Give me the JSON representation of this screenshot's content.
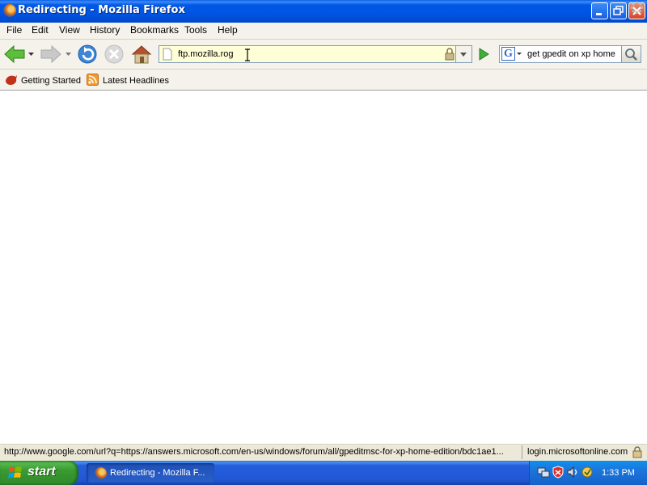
{
  "window": {
    "title": "Redirecting - Mozilla Firefox"
  },
  "menu": [
    "File",
    "Edit",
    "View",
    "History",
    "Bookmarks",
    "Tools",
    "Help"
  ],
  "navigation": {
    "url": "ftp.mozilla.rog",
    "search_engine_icon": "G",
    "search_query": "get gpedit on xp home"
  },
  "bookmarks": [
    "Getting Started",
    "Latest Headlines"
  ],
  "status": {
    "link": "http://www.google.com/url?q=https://answers.microsoft.com/en-us/windows/forum/all/gpeditmsc-for-xp-home-edition/bdc1ae1...",
    "domain": "login.microsoftonline.com"
  },
  "taskbar": {
    "start_label": "start",
    "task_label": "Redirecting - Mozilla F...",
    "clock": "1:33 PM"
  },
  "colors": {
    "titlebar": "#0054E3",
    "taskbar": "#245EDB",
    "start_button": "#3A9A32",
    "url_background": "#FEFFD6"
  }
}
